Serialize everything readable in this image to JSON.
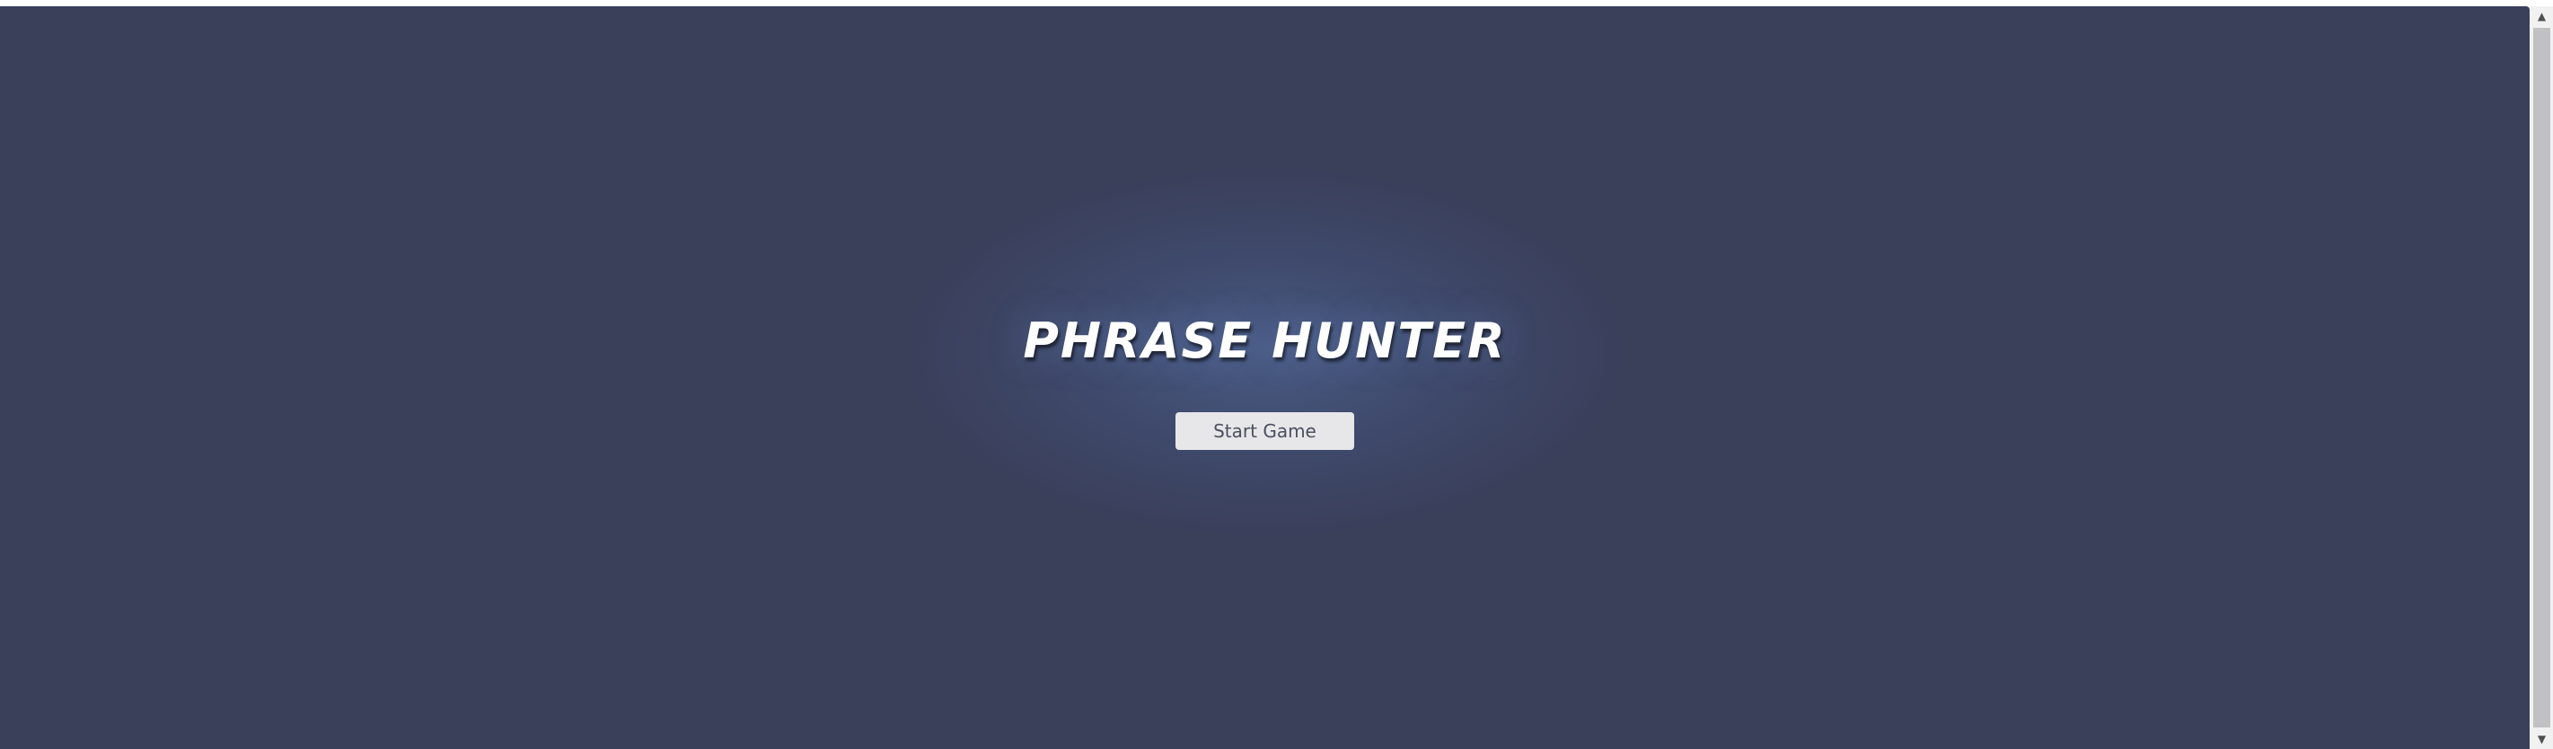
{
  "game": {
    "title": "PHRASE HUNTER",
    "start_button_label": "Start Game"
  },
  "scrollbar": {
    "up_arrow": "▲",
    "down_arrow": "▼"
  },
  "colors": {
    "background": "#3a3f5a",
    "title": "#ffffff",
    "button_bg": "#e7e7ea",
    "button_text": "#4b4f5e"
  }
}
